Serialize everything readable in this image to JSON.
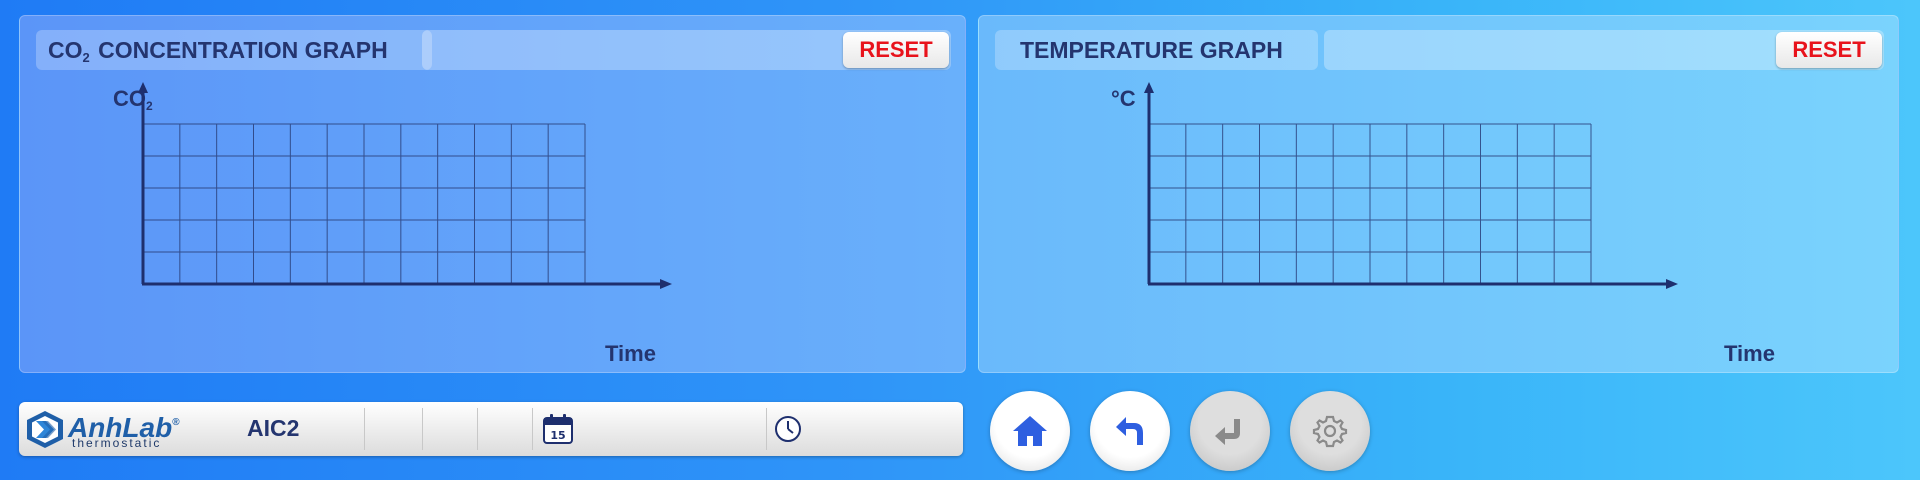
{
  "co2_panel": {
    "title_main": "CO",
    "title_sub": "2",
    "title_rest": " CONCENTRATION GRAPH",
    "reset_label": "RESET",
    "y_label_main": "CO",
    "y_label_sub": "2",
    "x_label": "Time"
  },
  "temp_panel": {
    "title": "TEMPERATURE GRAPH",
    "reset_label": "RESET",
    "y_label": "°C",
    "x_label": "Time"
  },
  "status_bar": {
    "logo_name": "AnhLab",
    "logo_reg": "®",
    "logo_sub": "thermostatic",
    "device_name": "AIC2",
    "calendar_icon": "calendar-icon",
    "clock_icon": "clock-icon",
    "calendar_day": "15"
  },
  "nav_buttons": [
    {
      "icon": "home-icon",
      "enabled": true
    },
    {
      "icon": "back-icon",
      "enabled": true
    },
    {
      "icon": "enter-icon",
      "enabled": false
    },
    {
      "icon": "gear-icon",
      "enabled": false
    }
  ],
  "colors": {
    "accent_text": "#24356f",
    "reset_text": "#e8131c",
    "grid_line": "#2a3f7a"
  }
}
